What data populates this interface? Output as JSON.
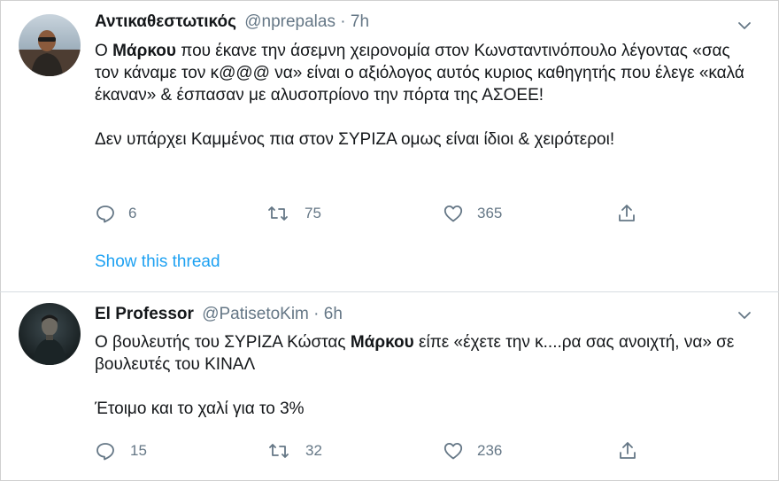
{
  "colors": {
    "text": "#14171a",
    "secondary": "#657786",
    "link": "#1da1f2",
    "divider": "#d7dde2"
  },
  "tweets": [
    {
      "avatar_icon": "user-avatar",
      "name": "Αντικαθεστωτικός",
      "handle": "@nprepalas",
      "separator": "·",
      "time": "7h",
      "text": {
        "p1_pre": "Ο ",
        "p1_bold": "Μάρκου",
        "p1_post": " που έκανε την άσεμνη χειρονομία στον Κωνσταντινόπουλο λέγοντας «σας τον κάναμε τον κ@@@ να» είναι ο αξιόλογος αυτός κυριος καθηγητής που έλεγε «καλά έκαναν» & έσπασαν με αλυσοπρίονο την πόρτα της ΑΣΟΕΕ!",
        "p2": "Δεν υπάρχει Καμμένος πια στον ΣΥΡΙΖΑ ομως είναι ίδιοι & χειρότεροι!"
      },
      "replies": "6",
      "retweets": "75",
      "likes": "365",
      "show_thread": "Show this thread"
    },
    {
      "avatar_icon": "user-avatar",
      "name": "El Professor",
      "handle": "@PatisetoKim",
      "separator": "·",
      "time": "6h",
      "text": {
        "p1_pre": "Ο βουλευτής του ΣΥΡΙΖΑ Κώστας ",
        "p1_bold": "Μάρκου",
        "p1_post": " είπε «έχετε την κ....ρα σας ανοιχτή, να» σε βουλευτές του ΚΙΝΑΛ",
        "p2": "Έτοιμο και το χαλί για το 3%"
      },
      "replies": "15",
      "retweets": "32",
      "likes": "236"
    }
  ]
}
